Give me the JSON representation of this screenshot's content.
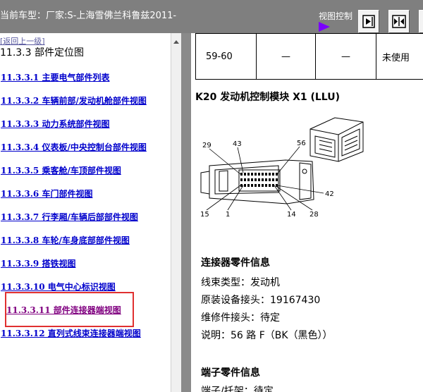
{
  "topbar": {
    "vehicle": "当前车型：厂家:S-上海雪佛兰科鲁兹2011-",
    "view_control": "视图控制"
  },
  "nav": {
    "back": "[返回上一级]",
    "section": "11.3.3  部件定位图",
    "items": [
      "11.3.3.1  主要电气部件列表",
      "11.3.3.2  车辆前部/发动机舱部件视图",
      "11.3.3.3  动力系统部件视图",
      "11.3.3.4  仪表板/中央控制台部件视图",
      "11.3.3.5  乘客舱/车顶部件视图",
      "11.3.3.6  车门部件视图",
      "11.3.3.7  行李厢/车辆后部部件视图",
      "11.3.3.8  车轮/车身底部部件视图",
      "11.3.3.9  搭铁视图",
      "11.3.3.10  电气中心标识视图",
      "11.3.3.11  部件连接器端视图",
      "11.3.3.12  直列式线束连接器端视图"
    ]
  },
  "content": {
    "table_row": [
      "59-60",
      "—",
      "—",
      "未使用"
    ],
    "module_title": "K20 发动机控制模块  X1 (LLU)",
    "pins": [
      "29",
      "43",
      "56",
      "42",
      "15",
      "1",
      "14",
      "28"
    ],
    "connector_info": {
      "heading": "连接器零件信息",
      "lines": [
        "线束类型：发动机",
        "原装设备接头：19167430",
        "维修件接头：待定",
        "说明：56 路  F（BK（黑色））"
      ]
    },
    "terminal_info": {
      "heading": "端子零件信息",
      "first_line": "端子/托架：待定"
    }
  },
  "colors": {
    "topbar_bg": "#7f7f7f",
    "link": "#0000cc",
    "visited_link": "#800080",
    "highlight_box": "#e03030",
    "view_arrow": "#7a00ff"
  }
}
